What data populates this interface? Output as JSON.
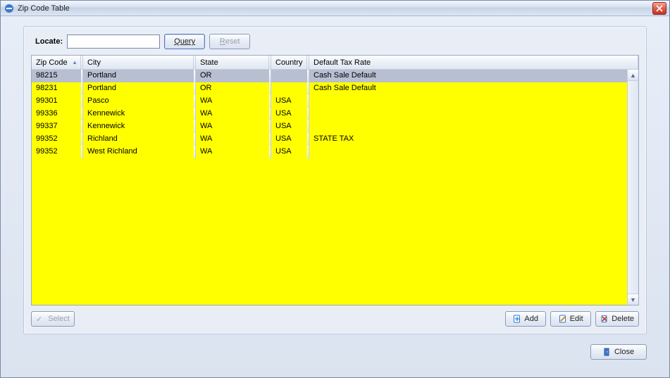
{
  "window": {
    "title": "Zip Code Table"
  },
  "locate": {
    "label": "Locate:",
    "value": "",
    "query_label": "Query",
    "reset_label": "Reset"
  },
  "columns": [
    {
      "label": "Zip Code",
      "sorted": true
    },
    {
      "label": "City"
    },
    {
      "label": "State"
    },
    {
      "label": "Country"
    },
    {
      "label": "Default Tax Rate"
    }
  ],
  "rows": [
    {
      "zip": "98215",
      "city": "Portland",
      "state": "OR",
      "country": "",
      "rate": "Cash Sale Default",
      "selected": true
    },
    {
      "zip": "98231",
      "city": "Portland",
      "state": "OR",
      "country": "",
      "rate": "Cash Sale Default",
      "selected": false
    },
    {
      "zip": "99301",
      "city": "Pasco",
      "state": "WA",
      "country": "USA",
      "rate": "",
      "selected": false
    },
    {
      "zip": "99336",
      "city": "Kennewick",
      "state": "WA",
      "country": "USA",
      "rate": "",
      "selected": false
    },
    {
      "zip": "99337",
      "city": "Kennewick",
      "state": "WA",
      "country": "USA",
      "rate": "",
      "selected": false
    },
    {
      "zip": "99352",
      "city": "Richland",
      "state": "WA",
      "country": "USA",
      "rate": "STATE TAX",
      "selected": false
    },
    {
      "zip": "99352",
      "city": "West Richland",
      "state": "WA",
      "country": "USA",
      "rate": "",
      "selected": false
    }
  ],
  "buttons": {
    "select": "Select",
    "add": "Add",
    "edit": "Edit",
    "delete": "Delete",
    "close": "Close"
  }
}
